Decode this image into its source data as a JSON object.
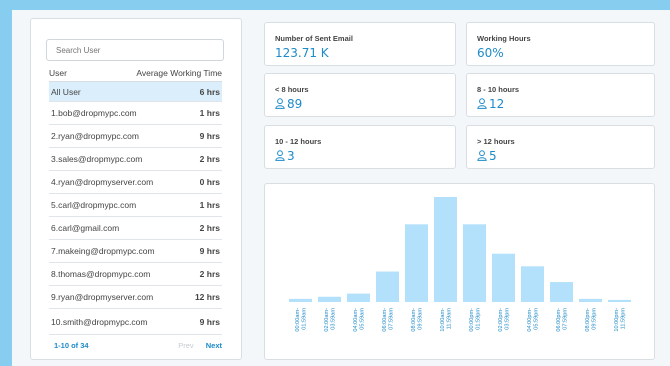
{
  "search": {
    "placeholder": "Search User"
  },
  "table": {
    "col_user": "User",
    "col_time": "Average Working Time",
    "rows": [
      {
        "user": "All User",
        "hours": "6 hrs"
      },
      {
        "user": "1.bob@dropmypc.com",
        "hours": "1 hrs"
      },
      {
        "user": "2.ryan@dropmypc.com",
        "hours": "9 hrs"
      },
      {
        "user": "3.sales@dropmypc.com",
        "hours": "2 hrs"
      },
      {
        "user": "4.ryan@dropmyserver.com",
        "hours": "0 hrs"
      },
      {
        "user": "5.carl@dropmypc.com",
        "hours": "1 hrs"
      },
      {
        "user": "6.carl@gmail.com",
        "hours": "2 hrs"
      },
      {
        "user": "7.makeing@dropmypc.com",
        "hours": "9 hrs"
      },
      {
        "user": "8.thomas@dropmypc.com",
        "hours": "2 hrs"
      },
      {
        "user": "9.ryan@dropmyserver.com",
        "hours": "12 hrs"
      },
      {
        "user": "10.smith@dropmypc.com",
        "hours": "9 hrs"
      }
    ]
  },
  "pager": {
    "count": "1-10 of 34",
    "prev": "Prev",
    "next": "Next"
  },
  "stats": {
    "sent_email": {
      "label": "Number of Sent Email",
      "value": "123.71 K"
    },
    "working_hours": {
      "label": "Working Hours",
      "value": "60%"
    },
    "lt8": {
      "label": "< 8 hours",
      "value": "89",
      "icon": "user-icon"
    },
    "h8_10": {
      "label": "8 - 10 hours",
      "value": "12",
      "icon": "user-icon"
    },
    "h10_12": {
      "label": "10 - 12 hours",
      "value": "3",
      "icon": "user-icon"
    },
    "gt12": {
      "label": "> 12 hours",
      "value": "5",
      "icon": "user-icon"
    }
  },
  "colors": {
    "accent": "#1d8ac9",
    "bar": "#b3e0fa",
    "frame": "#86cdf0"
  },
  "chart_data": {
    "type": "bar",
    "categories": [
      "00:00am-01:59am",
      "02:00am-03:59am",
      "04:00am-05:59am",
      "06:00am-07:59am",
      "08:00am-09:59am",
      "10:00am-11:59am",
      "00:00pm-01:59pm",
      "02:00pm-03:59pm",
      "04:00pm-05:59pm",
      "06:00pm-07:59pm",
      "08:00pm-09:59pm",
      "10:00pm-11:59pm"
    ],
    "values": [
      3,
      5,
      8,
      29,
      74,
      100,
      74,
      46,
      34,
      19,
      3,
      2
    ],
    "title": "",
    "xlabel": "",
    "ylabel": "",
    "ylim": [
      0,
      100
    ],
    "grid": false
  }
}
